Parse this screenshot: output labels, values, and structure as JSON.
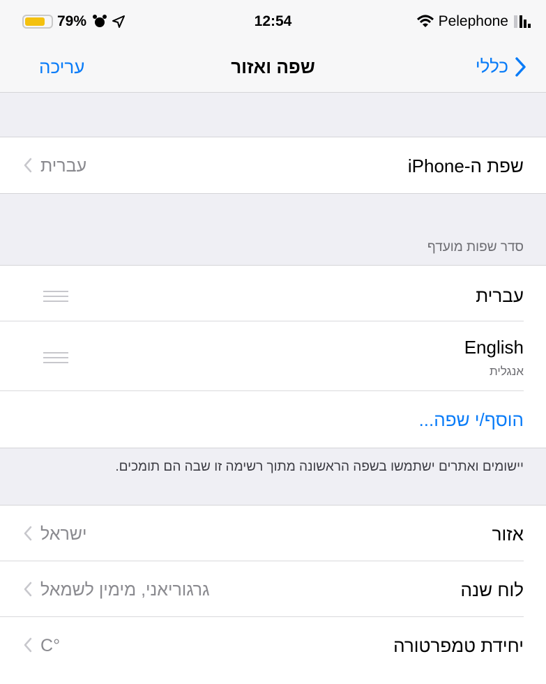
{
  "status_bar": {
    "battery_percent": "79%",
    "battery_level": 0.79,
    "time": "12:54",
    "carrier": "Pelephone"
  },
  "nav": {
    "back_label": "כללי",
    "title": "שפה ואזור",
    "edit_label": "עריכה"
  },
  "iphone_language": {
    "label": "שפת ה-iPhone",
    "value": "עברית"
  },
  "preferred_order": {
    "header": "סדר שפות מועדף",
    "languages": [
      {
        "name": "עברית",
        "subtitle": ""
      },
      {
        "name": "English",
        "subtitle": "אנגלית"
      }
    ],
    "add_label": "הוסף/י שפה...",
    "footer": "יישומים ואתרים ישתמשו בשפה הראשונה מתוך רשימה זו שבה הם תומכים."
  },
  "region_settings": [
    {
      "label": "אזור",
      "value": "ישראל"
    },
    {
      "label": "לוח שנה",
      "value": "גרגוריאני, מימין לשמאל"
    },
    {
      "label": "יחידת טמפרטורה",
      "value": "°C"
    }
  ],
  "colors": {
    "accent": "#0a7cf8",
    "background": "#efeff4",
    "battery": "#f4c10f"
  }
}
